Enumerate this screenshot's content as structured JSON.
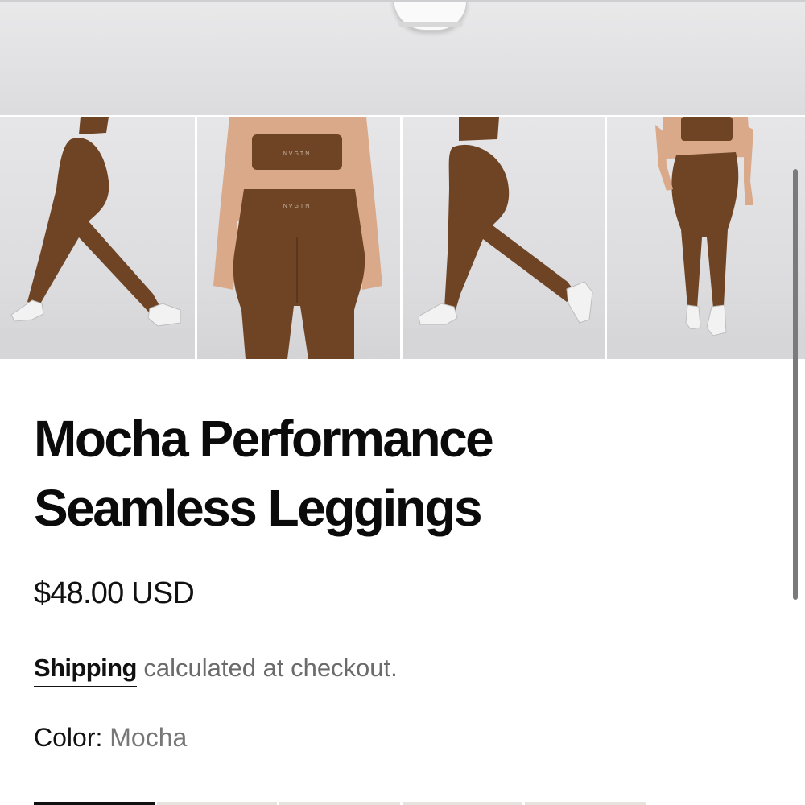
{
  "product": {
    "title_line1": "Mocha Performance",
    "title_line2": "Seamless Leggings",
    "price": "$48.00 USD",
    "shipping_link": "Shipping",
    "shipping_text": " calculated at checkout.",
    "color_label": "Color: ",
    "color_value": "Mocha"
  },
  "gallery": {
    "brand_mark": "NVGTN",
    "thumbnails": [
      "side-view",
      "back-view",
      "side-view-2",
      "front-view"
    ]
  },
  "colors": {
    "accent": "#111111",
    "product_brown": "#6e4424"
  }
}
